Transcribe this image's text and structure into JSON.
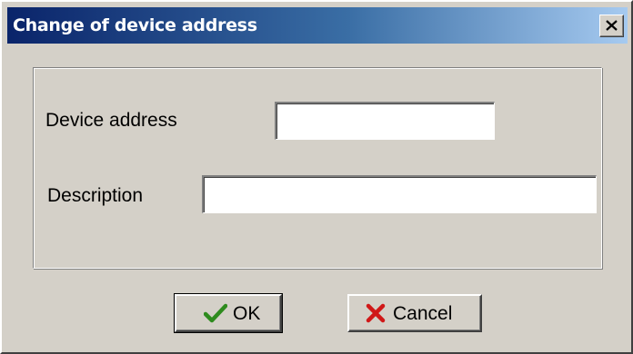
{
  "window": {
    "title": "Change of device address",
    "close_icon": "close-x-icon"
  },
  "form": {
    "device_address_label": "Device address",
    "device_address_value": "",
    "description_label": "Description",
    "description_value": ""
  },
  "buttons": {
    "ok_label": "OK",
    "ok_icon": "checkmark-icon",
    "ok_icon_color": "#2e8b1e",
    "cancel_label": "Cancel",
    "cancel_icon": "red-x-icon",
    "cancel_icon_color": "#d01818"
  },
  "colors": {
    "titlebar_start": "#0a246a",
    "titlebar_end": "#a6caf0",
    "dialog_face": "#d4d0c8"
  }
}
